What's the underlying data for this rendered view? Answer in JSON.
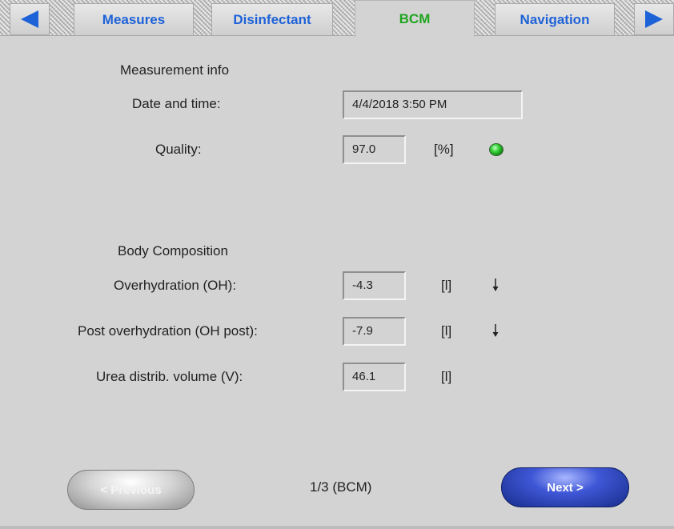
{
  "tabs": [
    {
      "label": "Measures",
      "active": false
    },
    {
      "label": "Disinfectant",
      "active": false
    },
    {
      "label": "BCM",
      "active": true
    },
    {
      "label": "Navigation",
      "active": false
    }
  ],
  "colors": {
    "tab_text": "#1e62d8",
    "active_tab_text": "#1ea51e",
    "arrow": "#1e62d8",
    "status_led": "#2ecc2e"
  },
  "measurement_info": {
    "title": "Measurement info",
    "date_label": "Date and time:",
    "date_value": "4/4/2018 3:50 PM",
    "quality_label": "Quality:",
    "quality_value": "97.0",
    "quality_unit": "[%]"
  },
  "body_composition": {
    "title": "Body Composition",
    "rows": [
      {
        "label": "Overhydration (OH):",
        "value": "-4.3",
        "unit": "[l]",
        "trend": "down-arrow-icon"
      },
      {
        "label": "Post overhydration (OH post):",
        "value": "-7.9",
        "unit": "[l]",
        "trend": "down-arrow-icon"
      },
      {
        "label": "Urea distrib. volume (V):",
        "value": "46.1",
        "unit": "[l]",
        "trend": ""
      }
    ]
  },
  "footer": {
    "prev_label": "< Previous",
    "next_label": "Next >",
    "page_indicator": "1/3 (BCM)"
  }
}
